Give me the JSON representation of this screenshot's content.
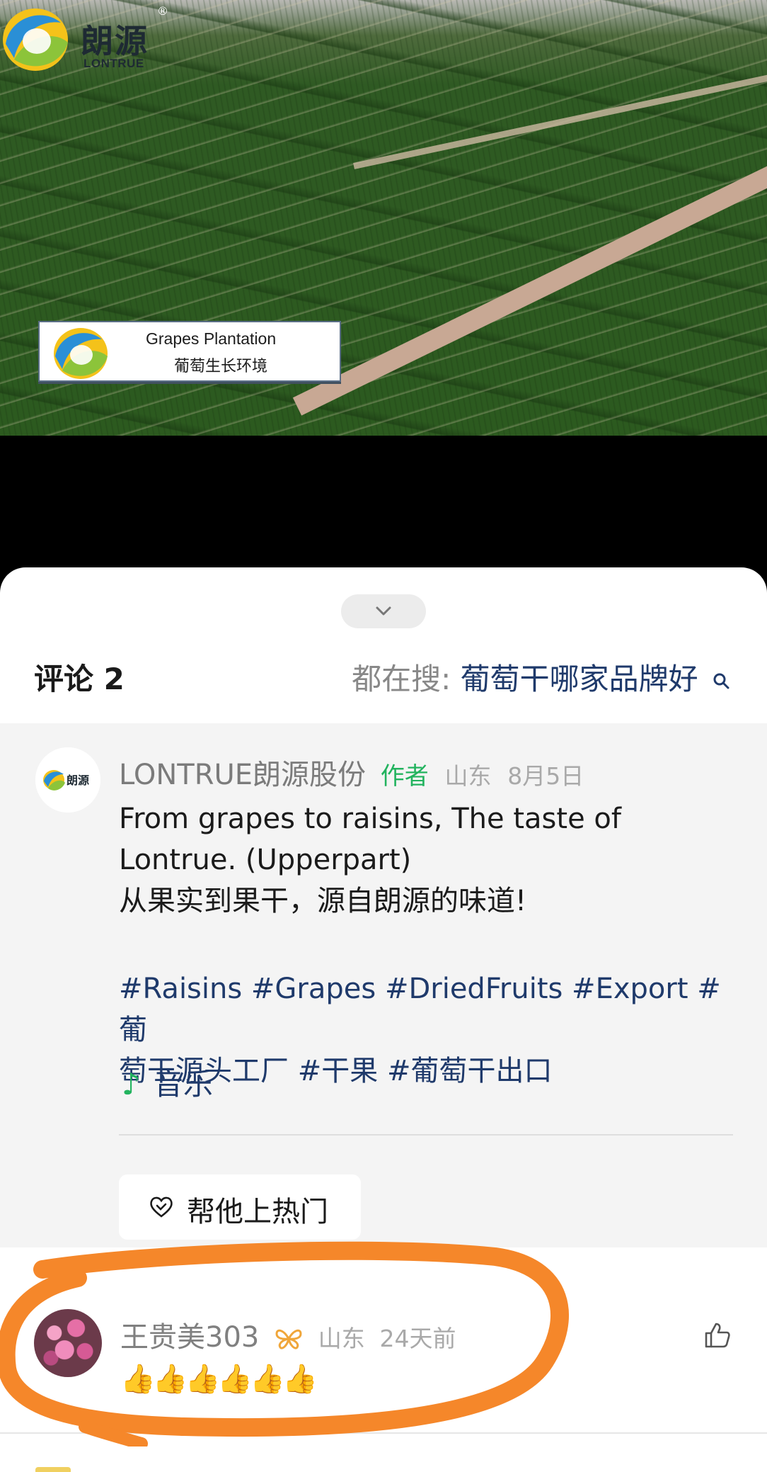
{
  "video": {
    "brand_cn": "朗源",
    "brand_en": "LONTRUE",
    "registered_mark": "®",
    "caption_en": "Grapes Plantation",
    "caption_cn": "葡萄生长环境"
  },
  "sheet": {
    "header_title": "评论 2",
    "search_prefix": "都在搜:",
    "search_query": "葡萄干哪家品牌好",
    "search_icon": "search-icon",
    "collapse_icon": "chevron-down-icon"
  },
  "author_comment": {
    "name": "LONTRUE朗源股份",
    "badge": "作者",
    "location": "山东",
    "date": "8月5日",
    "text_lines": [
      "From grapes to raisins, The taste of",
      "Lontrue. (Upperpart)",
      "从果实到果干，源自朗源的味道!"
    ],
    "hashtags_line1": "#Raisins #Grapes #DriedFruits #Export #葡",
    "hashtags_line2": "萄干源头工厂 #干果 #葡萄干出口",
    "music_label": "音乐",
    "boost_label": "帮他上热门"
  },
  "user_comment": {
    "name": "王贵美303",
    "location": "山东",
    "time": "24天前",
    "content": "👍👍👍👍👍👍"
  },
  "colors": {
    "link_blue": "#1f3a6b",
    "author_green": "#22b35e",
    "highlight_orange": "#f5872a",
    "sheet_gray": "#f4f4f4"
  }
}
